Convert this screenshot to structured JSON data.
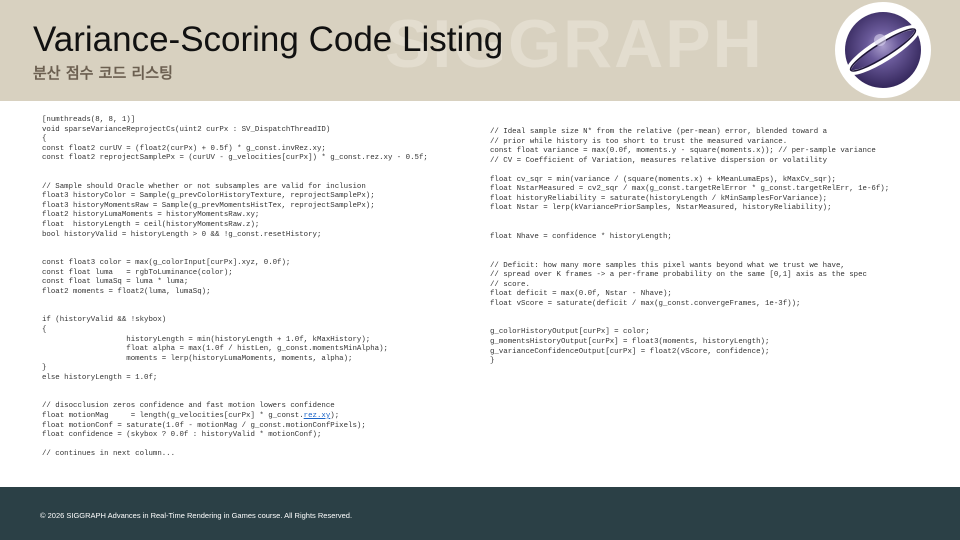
{
  "slide": {
    "title": "Variance-Scoring Code Listing",
    "subtitle": "분산 점수 코드 리스팅",
    "watermark": "SIGGRAPH",
    "footer": "© 2026 SIGGRAPH Advances in Real-Time Rendering in Games course. All Rights Reserved."
  },
  "colors": {
    "header_bg": "#d8d1c0",
    "footer_bg": "#2b4046",
    "code_text": "#333333",
    "highlight": "#1b64c8",
    "logo_dark": "#3e2e6a"
  },
  "icons": {
    "logo": "siggraph-logo-icon"
  },
  "code": {
    "left": {
      "before_highlight": "[numthreads(8, 8, 1)]\nvoid sparseVarianceReprojectCs(uint2 curPx : SV_DispatchThreadID)\n{\nconst float2 curUV = (float2(curPx) + 0.5f) * g_const.invRez.xy;\nconst float2 reprojectSamplePx = (curUV - g_velocities[curPx]) * g_const.rez.xy - 0.5f;\n\n\n// Sample should Oracle whether or not subsamples are valid for inclusion\nfloat3 historyColor = Sample(g_prevColorHistoryTexture, reprojectSamplePx);\nfloat3 historyMomentsRaw = Sample(g_prevMomentsHistTex, reprojectSamplePx);\nfloat2 historyLumaMoments = historyMomentsRaw.xy;\nfloat  historyLength = ceil(historyMomentsRaw.z);\nbool historyValid = historyLength > 0 && !g_const.resetHistory;\n\n\nconst float3 color = max(g_colorInput[curPx].xyz, 0.0f);\nconst float luma   = rgbToLuminance(color);\nconst float lumaSq = luma * luma;\nfloat2 moments = float2(luma, lumaSq);\n\n\nif (historyValid && !skybox)\n{\n                   historyLength = min(historyLength + 1.0f, kMaxHistory);\n                   float alpha = max(1.0f / histLen, g_const.momentsMinAlpha);\n                   moments = lerp(historyLumaMoments, moments, alpha);\n}\nelse historyLength = 1.0f;\n\n\n// disocclusion zeros confidence and fast motion lowers confidence\nfloat motionMag     = length(g_velocities[curPx] * g_const.",
      "highlight": "rez.xy",
      "after_highlight": ");\nfloat motionConf = saturate(1.0f - motionMag / g_const.motionConfPixels);\nfloat confidence = (skybox ? 0.0f : historyValid * motionConf);\n\n// continues in next column..."
    },
    "right": {
      "text": "// Ideal sample size N* from the relative (per-mean) error, blended toward a\n// prior while history is too short to trust the measured variance.\nconst float variance = max(0.0f, moments.y - square(moments.x)); // per-sample variance\n// CV = Coefficient of Variation, measures relative dispersion or volatility\n\nfloat cv_sqr = min(variance / (square(moments.x) + kMeanLumaEps), kMaxCv_sqr);\nfloat NstarMeasured = cv2_sqr / max(g_const.targetRelError * g_const.targetRelErr, 1e-6f);\nfloat historyReliability = saturate(historyLength / kMinSamplesForVariance);\nfloat Nstar = lerp(kVariancePriorSamples, NstarMeasured, historyReliability);\n\n\nfloat Nhave = confidence * historyLength;\n\n\n// Deficit: how many more samples this pixel wants beyond what we trust we have,\n// spread over K frames -> a per-frame probability on the same [0,1] axis as the spec\n// score.\nfloat deficit = max(0.0f, Nstar - Nhave);\nfloat vScore = saturate(deficit / max(g_const.convergeFrames, 1e-3f));\n\n\ng_colorHistoryOutput[curPx] = color;\ng_momentsHistoryOutput[curPx] = float3(moments, historyLength);\ng_varianceConfidenceOutput[curPx] = float2(vScore, confidence);\n}"
    }
  }
}
